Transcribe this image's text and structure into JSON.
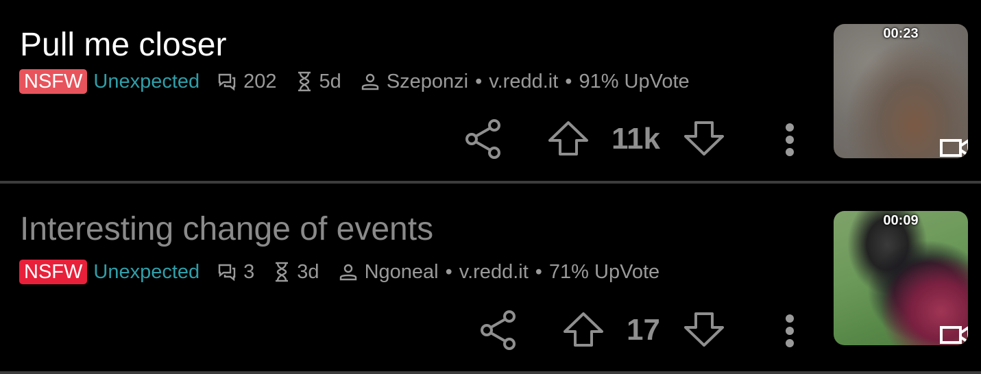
{
  "posts": [
    {
      "title": "Pull me closer",
      "nsfw": "NSFW",
      "flair": "Unexpected",
      "comments": "202",
      "age": "5d",
      "author": "Szeponzi",
      "domain": "v.redd.it",
      "upvote": "91% UpVote",
      "score": "11k",
      "duration": "00:23"
    },
    {
      "title": "Interesting change of events",
      "nsfw": "NSFW",
      "flair": "Unexpected",
      "comments": "3",
      "age": "3d",
      "author": "Ngoneal",
      "domain": "v.redd.it",
      "upvote": "71% UpVote",
      "score": "17",
      "duration": "00:09"
    }
  ],
  "separator": "•",
  "icons": {
    "comments": "comments-icon",
    "age": "hourglass-icon",
    "author": "person-icon",
    "share": "share-icon",
    "upvote": "upvote-arrow-icon",
    "downvote": "downvote-arrow-icon",
    "more": "more-vertical-icon",
    "video": "video-camera-icon"
  },
  "colors": {
    "background": "#000000",
    "nsfw_badge_1": "#e8545c",
    "nsfw_badge_2": "#e8203a",
    "flair": "#2e9fa9",
    "meta_text": "#9a9a9a",
    "read_title": "#8a8a8a"
  }
}
